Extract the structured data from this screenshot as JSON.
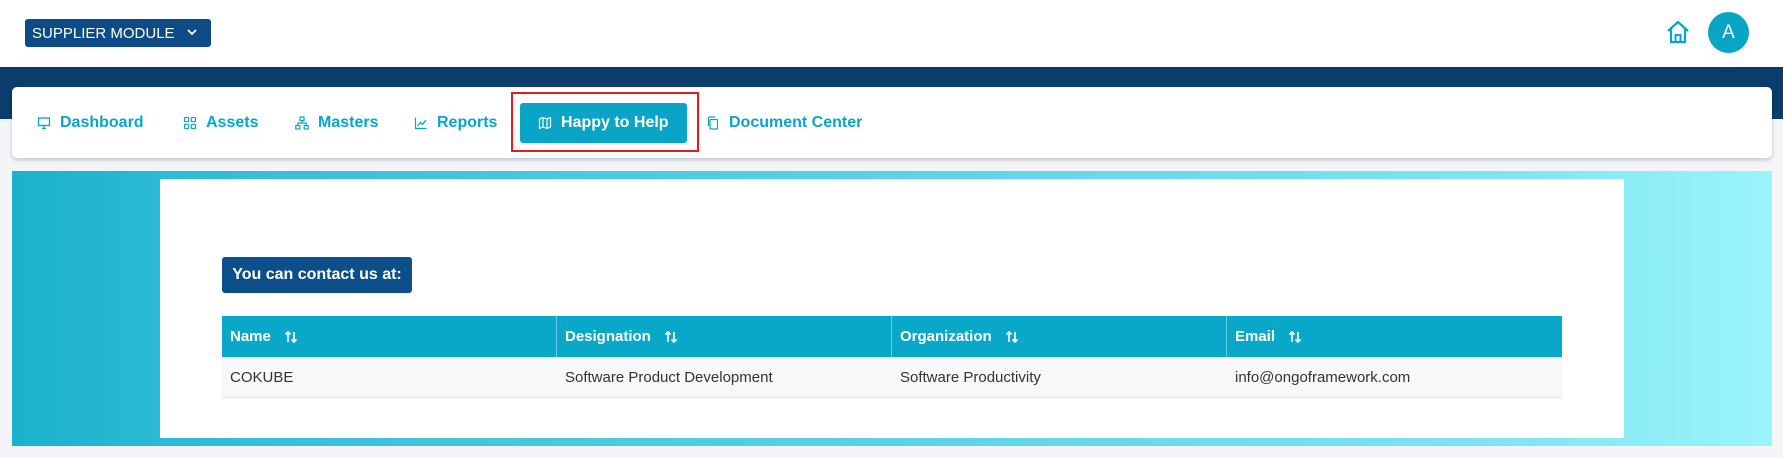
{
  "header": {
    "module_label": "SUPPLIER MODULE",
    "avatar_letter": "A"
  },
  "nav": {
    "items": [
      {
        "label": "Dashboard",
        "icon": "monitor-icon"
      },
      {
        "label": "Assets",
        "icon": "grid-icon"
      },
      {
        "label": "Masters",
        "icon": "sitemap-icon"
      },
      {
        "label": "Reports",
        "icon": "chart-line-icon"
      },
      {
        "label": "Happy to Help",
        "icon": "map-icon",
        "active": true
      },
      {
        "label": "Document Center",
        "icon": "copy-icon"
      }
    ]
  },
  "contact": {
    "heading": "You can contact us at:"
  },
  "table": {
    "columns": [
      "Name",
      "Designation",
      "Organization",
      "Email"
    ],
    "rows": [
      [
        "COKUBE",
        "Software Product Development",
        "Software Productivity",
        "info@ongoframework.com"
      ]
    ]
  },
  "colors": {
    "primary": "#0aa5c6",
    "navy": "#0a3d6b",
    "highlight": "#e01e1e"
  }
}
